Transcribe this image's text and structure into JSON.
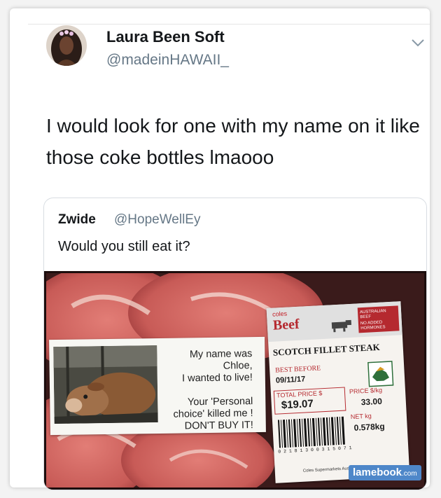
{
  "tweet": {
    "display_name": "Laura Been Soft",
    "handle": "@madeinHAWAII_",
    "text": "I would look for one with my name on it like those coke bottles lmaooo",
    "menu_icon": "chevron-down-icon"
  },
  "quoted_tweet": {
    "display_name": "Zwide",
    "handle": "@HopeWellEy",
    "text": "Would you still eat it?",
    "image": {
      "note": {
        "line1": "My name was",
        "line2": "Chloe,",
        "line3": "I wanted to live!",
        "line4": "Your 'Personal",
        "line5": "choice' killed me !",
        "line6": "DON'T BUY IT!"
      },
      "label": {
        "brand": "coles",
        "category": "Beef",
        "badge1": "AUSTRALIAN BEEF",
        "badge2": "NO ADDED HORMONES",
        "product": "SCOTCH FILLET STEAK",
        "best_before_label": "BEST BEFORE",
        "best_before": "09/11/17",
        "total_price_label": "TOTAL PRICE $",
        "total_price": "$19.07",
        "price_per_kg_label": "PRICE $/kg",
        "price_per_kg": "33.00",
        "net_label": "NET kg",
        "net_weight": "0.578kg",
        "barcode_digits": "0 2 1 8 1 3 0 0 3 1 5 0 7 1",
        "footer": "Coles Supermarkets Australia"
      }
    }
  },
  "watermark": {
    "name": "lamebook",
    "suffix": ".com"
  }
}
